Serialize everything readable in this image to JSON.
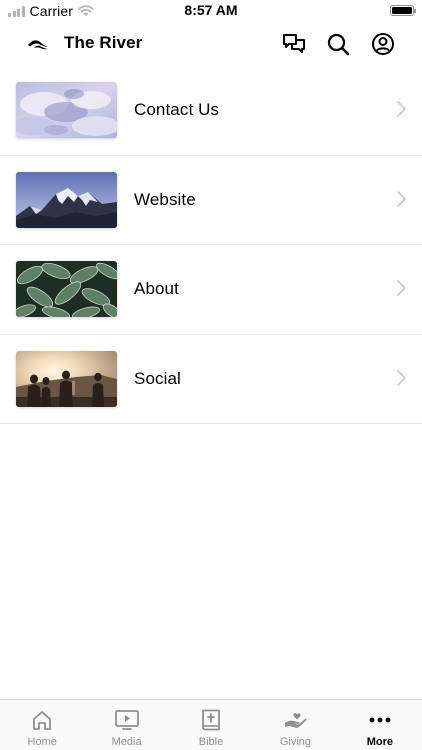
{
  "status": {
    "carrier": "Carrier",
    "time": "8:57 AM",
    "battery_level": 1.0
  },
  "header": {
    "title": "The River",
    "logo_icon": "river-logo-icon",
    "actions": [
      {
        "icon": "chat-bubbles-icon"
      },
      {
        "icon": "search-icon"
      },
      {
        "icon": "user-profile-icon"
      }
    ]
  },
  "items": [
    {
      "label": "Contact Us",
      "image": "cloudy-sky-photo"
    },
    {
      "label": "Website",
      "image": "snowy-mountain-photo"
    },
    {
      "label": "About",
      "image": "green-leaves-photo"
    },
    {
      "label": "Social",
      "image": "friends-sunset-photo"
    }
  ],
  "tabs": [
    {
      "label": "Home",
      "icon": "home-icon",
      "active": false
    },
    {
      "label": "Media",
      "icon": "media-play-icon",
      "active": false
    },
    {
      "label": "Bible",
      "icon": "bible-icon",
      "active": false
    },
    {
      "label": "Giving",
      "icon": "giving-hand-icon",
      "active": false
    },
    {
      "label": "More",
      "icon": "more-dots-icon",
      "active": true
    }
  ],
  "colors": {
    "text": "#000000",
    "inactive_tab": "#8e8e93",
    "divider": "#e6e6e6",
    "chevron": "#c7c7cc"
  }
}
